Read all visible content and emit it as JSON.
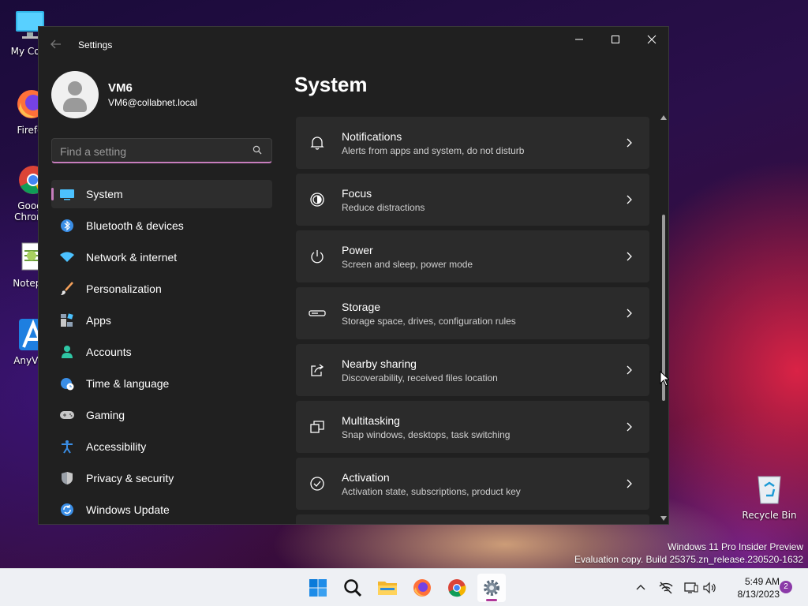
{
  "desktop": {
    "icons": [
      {
        "label": "My Com",
        "icon": "computer-icon"
      },
      {
        "label": "Firefo",
        "icon": "firefox-icon"
      },
      {
        "label": "Goog",
        "label2": "Chrom",
        "icon": "chrome-icon"
      },
      {
        "label": "Notepa",
        "icon": "notepad-icon"
      },
      {
        "label": "AnyVie",
        "icon": "anyviewer-icon"
      },
      {
        "label": "Recycle Bin",
        "icon": "recycle-bin-icon"
      }
    ],
    "watermark": {
      "line1": "Windows 11 Pro Insider Preview",
      "line2": "Evaluation copy. Build 25375.zn_release.230520-1632"
    }
  },
  "window": {
    "title": "Settings",
    "controls": {
      "minimize": "minimize-icon",
      "maximize": "maximize-icon",
      "close": "close-icon"
    }
  },
  "profile": {
    "name": "VM6",
    "email": "VM6@collabnet.local"
  },
  "search": {
    "placeholder": "Find a setting",
    "value": ""
  },
  "nav": [
    {
      "label": "System",
      "icon": "system-icon",
      "active": true
    },
    {
      "label": "Bluetooth & devices",
      "icon": "bluetooth-icon"
    },
    {
      "label": "Network & internet",
      "icon": "wifi-icon"
    },
    {
      "label": "Personalization",
      "icon": "brush-icon"
    },
    {
      "label": "Apps",
      "icon": "apps-icon"
    },
    {
      "label": "Accounts",
      "icon": "accounts-icon"
    },
    {
      "label": "Time & language",
      "icon": "globe-clock-icon"
    },
    {
      "label": "Gaming",
      "icon": "gamepad-icon"
    },
    {
      "label": "Accessibility",
      "icon": "accessibility-icon"
    },
    {
      "label": "Privacy & security",
      "icon": "shield-icon"
    },
    {
      "label": "Windows Update",
      "icon": "update-icon"
    }
  ],
  "main": {
    "title": "System",
    "items": [
      {
        "title": "Notifications",
        "subtitle": "Alerts from apps and system, do not disturb",
        "icon": "bell-icon"
      },
      {
        "title": "Focus",
        "subtitle": "Reduce distractions",
        "icon": "focus-icon"
      },
      {
        "title": "Power",
        "subtitle": "Screen and sleep, power mode",
        "icon": "power-icon"
      },
      {
        "title": "Storage",
        "subtitle": "Storage space, drives, configuration rules",
        "icon": "storage-icon"
      },
      {
        "title": "Nearby sharing",
        "subtitle": "Discoverability, received files location",
        "icon": "share-icon"
      },
      {
        "title": "Multitasking",
        "subtitle": "Snap windows, desktops, task switching",
        "icon": "multitasking-icon"
      },
      {
        "title": "Activation",
        "subtitle": "Activation state, subscriptions, product key",
        "icon": "activation-icon"
      }
    ]
  },
  "taskbar": {
    "apps": [
      "start-icon",
      "search-icon",
      "file-explorer-icon",
      "firefox-icon",
      "chrome-icon",
      "settings-icon"
    ],
    "tray": [
      "chevron-up-icon",
      "network-disconnected-icon",
      "display-icon",
      "volume-icon"
    ],
    "time": "5:49 AM",
    "date": "8/13/2023",
    "notification_count": "2"
  },
  "colors": {
    "accent": "#c77dbd",
    "window_bg": "#202020",
    "card_bg": "#2b2b2b"
  }
}
